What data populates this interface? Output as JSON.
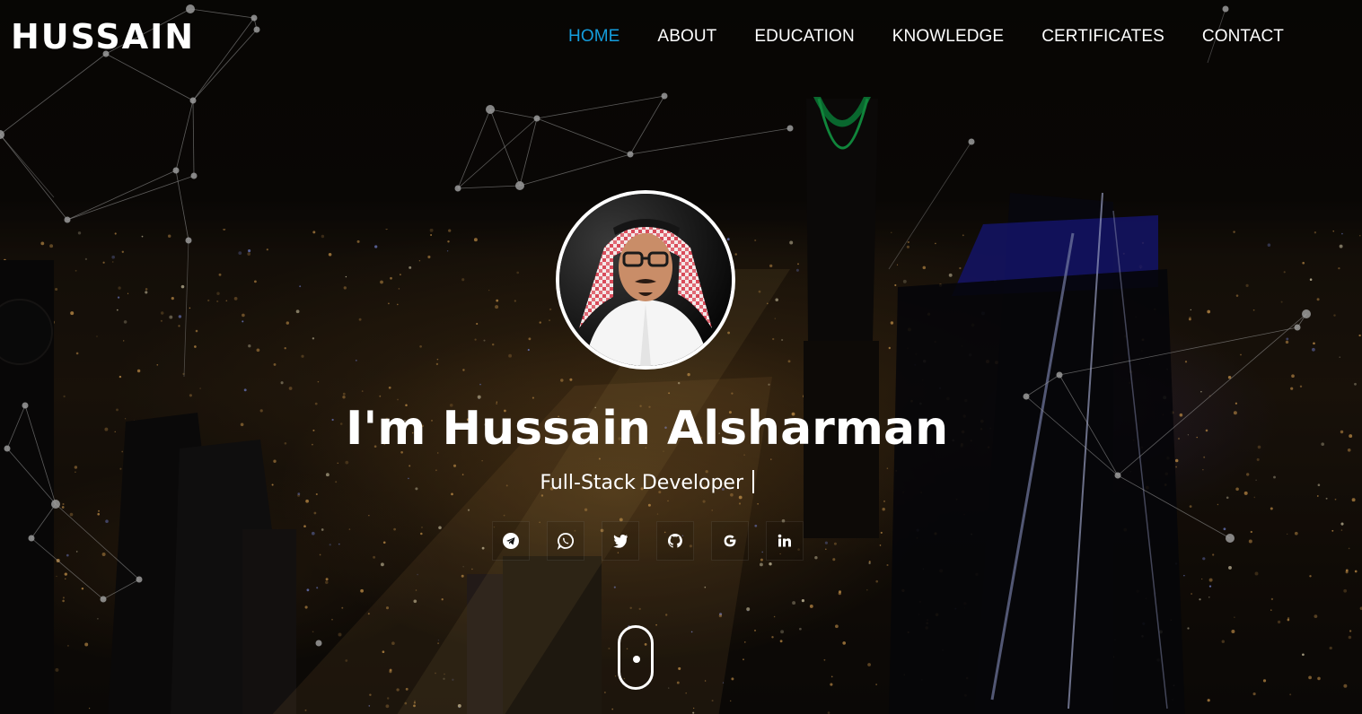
{
  "brand": {
    "name": "HUSSAIN"
  },
  "nav": {
    "items": [
      {
        "label": "HOME",
        "active": true
      },
      {
        "label": "ABOUT",
        "active": false
      },
      {
        "label": "EDUCATION",
        "active": false
      },
      {
        "label": "KNOWLEDGE",
        "active": false
      },
      {
        "label": "CERTIFICATES",
        "active": false
      },
      {
        "label": "CONTACT",
        "active": false
      }
    ]
  },
  "hero": {
    "title": "I'm Hussain Alsharman",
    "subtitle": "Full-Stack Developer"
  },
  "social": [
    {
      "icon": "telegram-icon"
    },
    {
      "icon": "whatsapp-icon"
    },
    {
      "icon": "twitter-icon"
    },
    {
      "icon": "github-icon"
    },
    {
      "icon": "google-icon"
    },
    {
      "icon": "linkedin-icon"
    }
  ],
  "colors": {
    "accent": "#149ddd",
    "text": "#ffffff",
    "background": "#0b0906"
  }
}
